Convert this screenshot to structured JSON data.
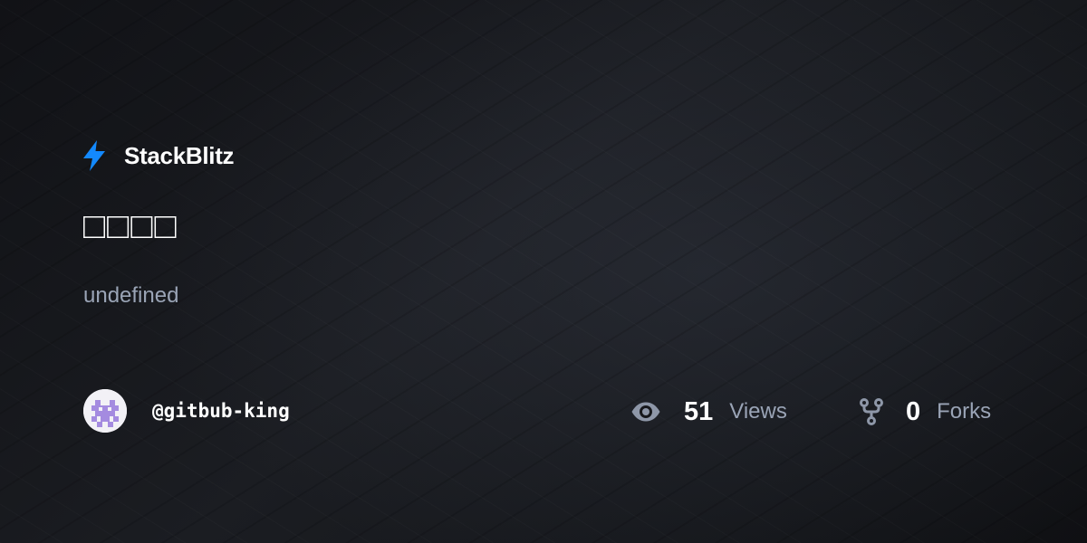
{
  "brand": {
    "name": "StackBlitz",
    "logo_icon": "lightning-bolt-icon",
    "accent_color": "#1389fd"
  },
  "project": {
    "title": "□□□□",
    "description": "undefined"
  },
  "author": {
    "username": "@gitbub-king",
    "avatar_icon": "pixel-avatar-icon",
    "avatar_color": "#a48be0"
  },
  "stats": {
    "views": {
      "icon": "eye-icon",
      "count": "51",
      "label": "Views"
    },
    "forks": {
      "icon": "fork-icon",
      "count": "0",
      "label": "Forks"
    }
  },
  "colors": {
    "background": "#141518",
    "text_primary": "#ffffff",
    "text_secondary": "#9aa4b6",
    "icon_muted": "#8e97a8"
  }
}
